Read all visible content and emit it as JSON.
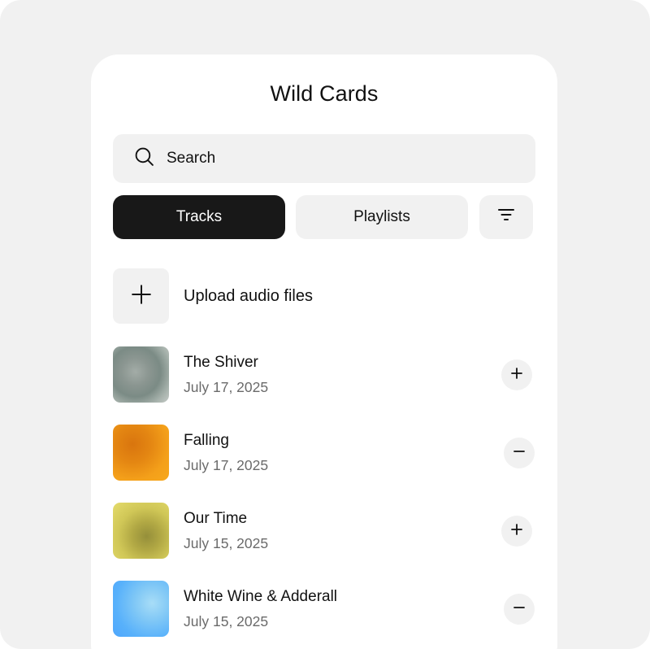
{
  "header": {
    "title": "Wild Cards"
  },
  "search": {
    "placeholder": "Search",
    "icon": "search-icon"
  },
  "tabs": [
    {
      "label": "Tracks",
      "active": true
    },
    {
      "label": "Playlists",
      "active": false
    }
  ],
  "filter": {
    "icon": "filter-icon"
  },
  "upload": {
    "label": "Upload audio files",
    "icon": "plus-icon"
  },
  "tracks": [
    {
      "name": "The Shiver",
      "date": "July 17, 2025",
      "action": "add"
    },
    {
      "name": "Falling",
      "date": "July 17, 2025",
      "action": "remove"
    },
    {
      "name": "Our Time",
      "date": "July 15, 2025",
      "action": "add"
    },
    {
      "name": "White Wine & Adderall",
      "date": "July 15, 2025",
      "action": "remove"
    }
  ],
  "colors": {
    "background": "#f1f1f1",
    "card": "#ffffff",
    "active_tab": "#181818",
    "secondary_text": "#6a6a6a"
  }
}
